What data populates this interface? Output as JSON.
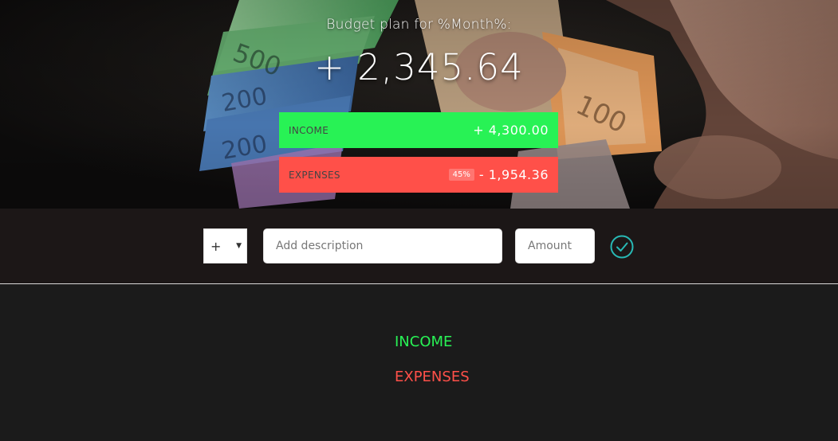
{
  "budget": {
    "title": "Budget plan for %Month%:",
    "value": "+ 2,345.64"
  },
  "summary": {
    "income": {
      "label": "INCOME",
      "value": "+ 4,300.00",
      "color": "#28f255"
    },
    "expenses": {
      "label": "EXPENSES",
      "percentage": "45%",
      "value": "- 1,954.36",
      "color": "#ff5049"
    }
  },
  "add_form": {
    "type_value": "+",
    "description_placeholder": "Add description",
    "amount_placeholder": "Amount",
    "submit_icon": "checkmark-circle-icon",
    "accent": "#28b9b5"
  },
  "lists": {
    "income_title": "INCOME",
    "expenses_title": "EXPENSES"
  },
  "background_image": "hands-holding-banknotes"
}
